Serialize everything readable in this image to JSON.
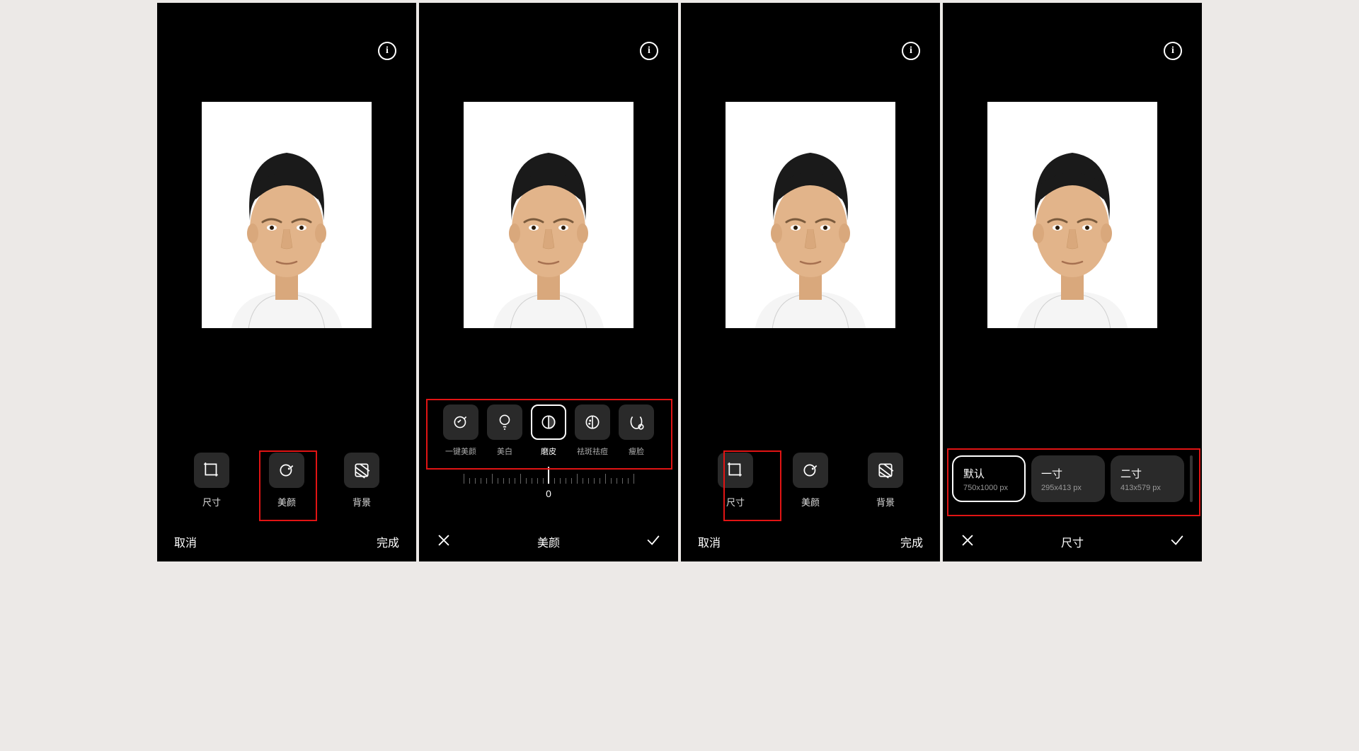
{
  "footer": {
    "cancel": "取消",
    "done": "完成",
    "beauty_title": "美颜",
    "size_title": "尺寸"
  },
  "tabs": {
    "size": "尺寸",
    "beauty": "美颜",
    "background": "背景"
  },
  "filters": {
    "one_key": "一键美颜",
    "whiten": "美白",
    "smooth": "磨皮",
    "spot": "祛斑祛痘",
    "slim": "瘦脸"
  },
  "slider_value": "0",
  "sizes": {
    "default_name": "默认",
    "default_dims": "750x1000 px",
    "one_inch_name": "一寸",
    "one_inch_dims": "295x413 px",
    "two_inch_name": "二寸",
    "two_inch_dims": "413x579 px"
  }
}
